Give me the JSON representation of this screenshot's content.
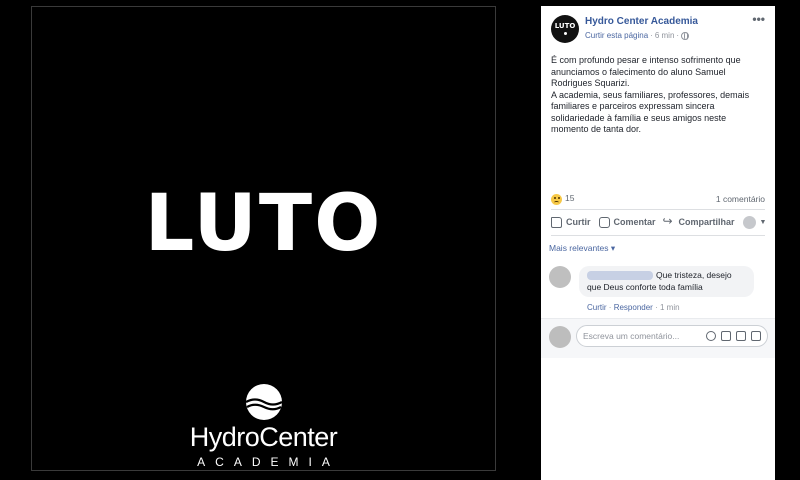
{
  "photo": {
    "headline": "LUTO",
    "logo_brand_a": "Hydro",
    "logo_brand_b": "Center",
    "logo_sub": "ACADEMIA"
  },
  "post": {
    "avatar_text": "LUTO",
    "page_name": "Hydro Center Academia",
    "like_page": "Curtir esta página",
    "separator": "·",
    "time": "6 min",
    "more": "•••",
    "paragraph1": "É com profundo pesar e intenso sofrimento que anunciamos o falecimento do aluno Samuel Rodrigues Squarizi.",
    "paragraph2": "A academia, seus familiares, professores, demais familiares e parceiros expressam sincera solidariedade à família e seus amigos neste momento de tanta dor.",
    "reaction_count": "15",
    "comment_count": "1 comentário",
    "actions": {
      "like": "Curtir",
      "comment": "Comentar",
      "share": "Compartilhar"
    }
  },
  "comments": {
    "sort_label": "Mais relevantes ▾",
    "items": [
      {
        "text": "Que tristeza, desejo que Deus conforte toda família",
        "like": "Curtir",
        "sep": "·",
        "reply": "Responder",
        "time": "1 min"
      }
    ],
    "placeholder": "Escreva um comentário..."
  }
}
